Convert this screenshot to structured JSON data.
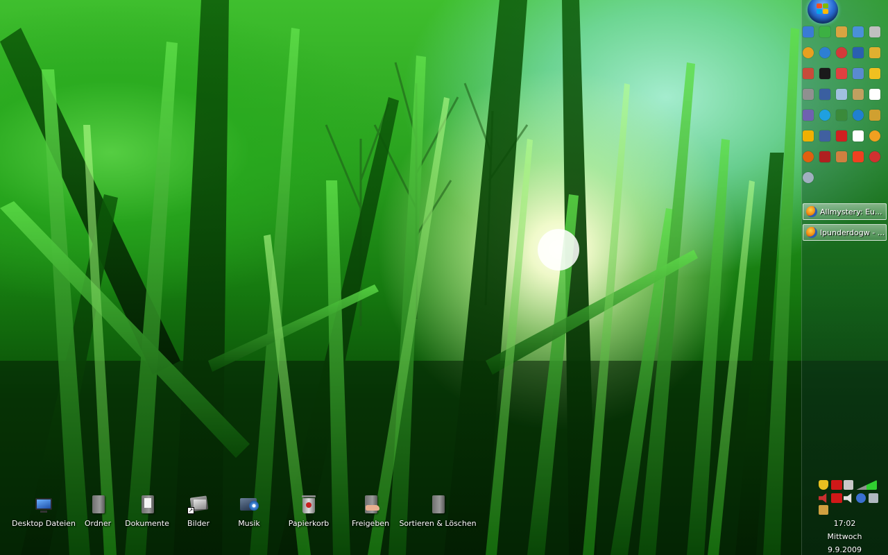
{
  "desktop_icons": [
    {
      "label": "Desktop Dateien",
      "icon": "monitor-icon"
    },
    {
      "label": "Ordner",
      "icon": "folder-icon"
    },
    {
      "label": "Dokumente",
      "icon": "document-folder-icon"
    },
    {
      "label": "Bilder",
      "icon": "pictures-folder-icon"
    },
    {
      "label": "Musik",
      "icon": "music-folder-icon"
    },
    {
      "label": "Papierkorb",
      "icon": "recycle-bin-icon"
    },
    {
      "label": "Freigeben",
      "icon": "shared-folder-icon"
    },
    {
      "label": "Sortieren & Löschen",
      "icon": "folder-icon"
    }
  ],
  "taskbar": {
    "start_button": "windows-orb-icon",
    "tasks": [
      {
        "title": "Allmystery: Eu...",
        "icon": "firefox-icon"
      },
      {
        "title": "lpunderdogw - ...",
        "icon": "firefox-icon"
      }
    ],
    "clock": {
      "time": "17:02",
      "day": "Mittwoch",
      "date": "9.9.2009"
    }
  },
  "quicklaunch_colors": [
    "#3a7bd5",
    "#3cb043",
    "#d9a441",
    "#4a90d9",
    "#c0c0c0",
    "#e8a020",
    "#2d7fd3",
    "#d23a3a",
    "#2a5fb0",
    "#e0b030",
    "#c84a3a",
    "#1a1a1a",
    "#e04040",
    "#5a8ad0",
    "#f0c020",
    "#909090",
    "#3a5fa0",
    "#a0c0e0",
    "#c0a060",
    "#e05050",
    "#7060b0",
    "#1fa0e0",
    "#3a8a3a",
    "#2080d0",
    "#d0a030",
    "#f0b000",
    "#4060a0",
    "#d02020",
    "#ffffff",
    "#f0a020",
    "#e06010",
    "#b02020",
    "#d08040",
    "#f04020",
    "#d03030",
    "#a0b0c0"
  ],
  "colors": {
    "sun": "#fffff0",
    "grass_dark": "#052e04",
    "grass_light": "#3fbf2e",
    "sky": "#aaf0d7"
  }
}
